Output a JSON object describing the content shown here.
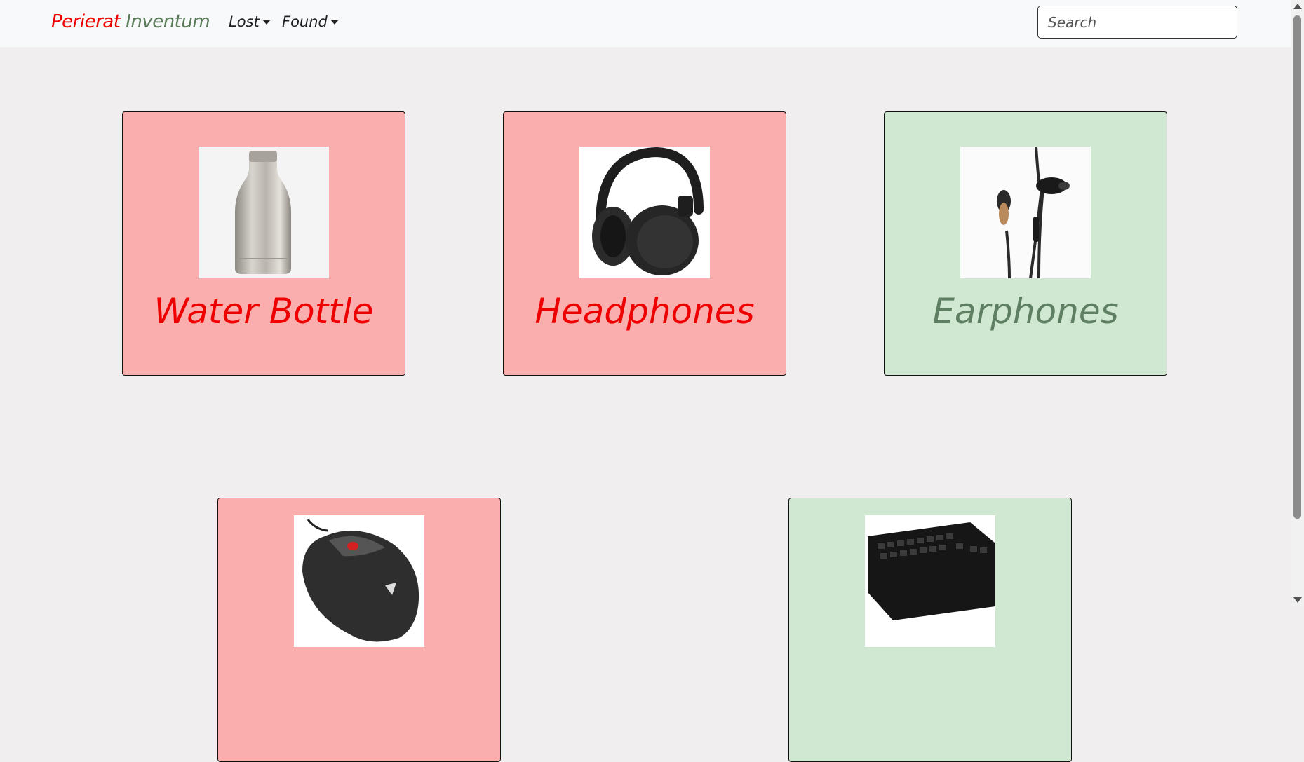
{
  "navbar": {
    "brand_part1": "Perierat",
    "brand_part2": "Inventum",
    "menu": [
      {
        "label": "Lost"
      },
      {
        "label": "Found"
      }
    ],
    "search_placeholder": "Search"
  },
  "items": [
    {
      "label": "Water Bottle",
      "status": "lost",
      "icon": "water-bottle-image"
    },
    {
      "label": "Headphones",
      "status": "lost",
      "icon": "headphones-image"
    },
    {
      "label": "Earphones",
      "status": "found",
      "icon": "earphones-image"
    },
    {
      "label": "",
      "status": "lost",
      "icon": "computer-mouse-image"
    },
    {
      "label": "",
      "status": "found",
      "icon": "keyboard-image"
    }
  ],
  "colors": {
    "lost_bg": "#fbaeae",
    "found_bg": "#d0e7d2",
    "lost_text": "#ee0000",
    "found_text": "#5f7f62",
    "page_bg": "#f0eeef"
  }
}
